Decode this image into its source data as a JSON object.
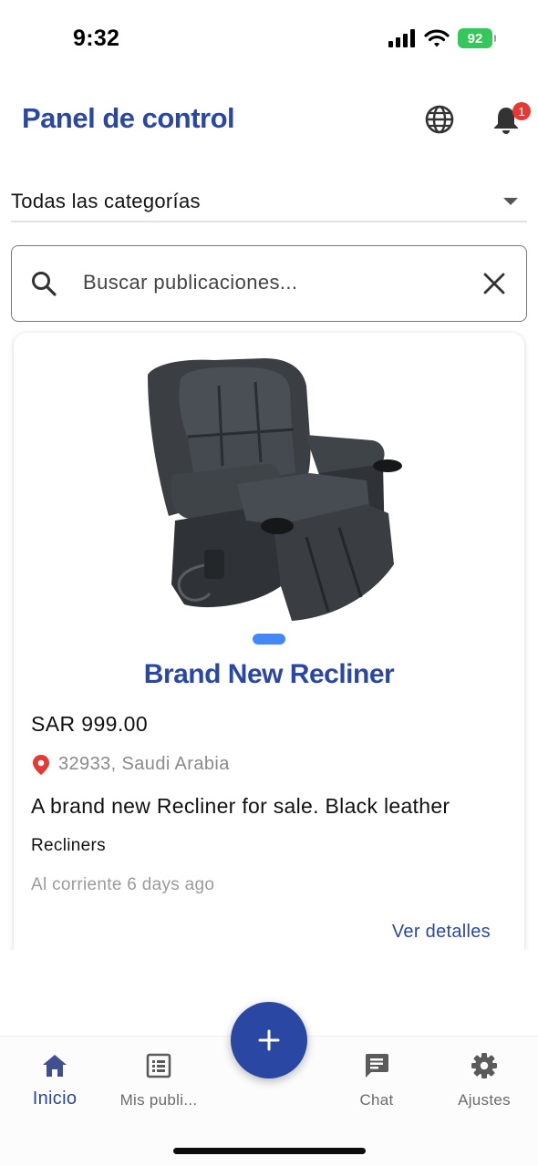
{
  "status_bar": {
    "time": "9:32",
    "battery": "92"
  },
  "header": {
    "title": "Panel de control",
    "notification_count": "1"
  },
  "filters": {
    "category_selected": "Todas las categorías"
  },
  "search": {
    "placeholder": "Buscar publicaciones..."
  },
  "listing": {
    "title": "Brand New Recliner",
    "price": "SAR 999.00",
    "location": "32933, Saudi Arabia",
    "description": "A brand new Recliner for sale. Black leather",
    "category": "Recliners",
    "posted": "Al corriente 6 days ago",
    "details_link": "Ver detalles",
    "image_icon": "recliner-chair-photo"
  },
  "bottom_nav": {
    "items": [
      {
        "label": "Inicio",
        "icon": "home-icon",
        "active": true
      },
      {
        "label": "Mis publi...",
        "icon": "list-icon",
        "active": false
      },
      {
        "label": "Chat",
        "icon": "chat-icon",
        "active": false
      },
      {
        "label": "Ajustes",
        "icon": "gear-icon",
        "active": false
      }
    ],
    "fab_icon": "plus-icon"
  },
  "colors": {
    "primary": "#2a47a4",
    "accent_dot": "#4388f5",
    "badge": "#e53935",
    "location_pin": "#e53935",
    "battery": "#34c759"
  }
}
